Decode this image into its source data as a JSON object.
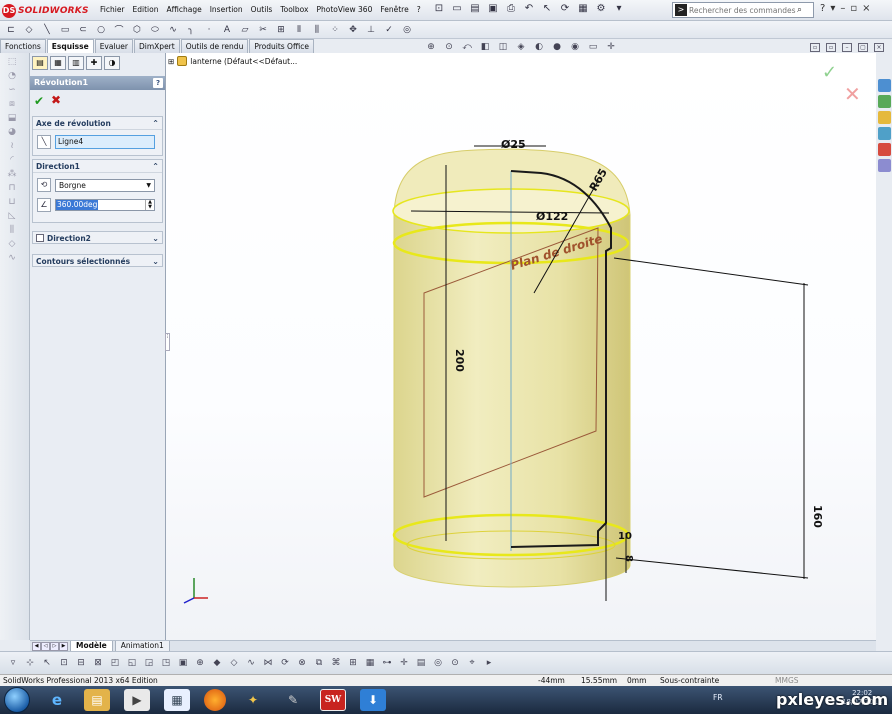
{
  "app": {
    "logo_text": "SOLIDWORKS",
    "logo_mark": "DS",
    "menus": [
      "Fichier",
      "Edition",
      "Affichage",
      "Insertion",
      "Outils",
      "Toolbox",
      "PhotoView 360",
      "Fenêtre",
      "?"
    ],
    "search": {
      "placeholder": "Rechercher des commandes",
      "prompt_glyph": ">"
    }
  },
  "tabs": [
    {
      "label": "Fonctions",
      "active": false
    },
    {
      "label": "Esquisse",
      "active": true
    },
    {
      "label": "Evaluer",
      "active": false
    },
    {
      "label": "DimXpert",
      "active": false
    },
    {
      "label": "Outils de rendu",
      "active": false
    },
    {
      "label": "Produits Office",
      "active": false
    }
  ],
  "feature_tree": {
    "root_label": "lanterne  (Défaut<<Défaut..."
  },
  "property_manager": {
    "title": "Révolution1",
    "help": "?",
    "axis_group": {
      "title": "Axe de révolution",
      "axis_value": "Ligne4"
    },
    "direction1": {
      "title": "Direction1",
      "type_value": "Borgne",
      "angle_value": "360.00deg"
    },
    "direction2": {
      "title": "Direction2"
    },
    "contours": {
      "title": "Contours sélectionnés"
    }
  },
  "dimensions": {
    "d_top": "Ø25",
    "d_body": "Ø122",
    "radius": "R65",
    "height_left": "200",
    "height_right": "160",
    "small_bottom": "10",
    "small_side": "8",
    "plane_label": "Plan de droite"
  },
  "bottom_tabs": [
    {
      "label": "Modèle",
      "active": true
    },
    {
      "label": "Animation1",
      "active": false
    }
  ],
  "status": {
    "product": "SolidWorks Professional 2013 x64 Edition",
    "x": "-44mm",
    "y": "15.55mm",
    "z": "0mm",
    "state": "Sous-contrainte",
    "units": "MMGS"
  },
  "taskbar": {
    "sw_label": "SW",
    "lang": "FR",
    "time": "22:02",
    "date": "18/07/2013"
  },
  "watermark": "pxleyes.com",
  "colors": {
    "body_fill": "#ece7a8",
    "body_edge": "#e6e61e",
    "sketch_line": "#1a1a1a",
    "plane_border": "#9b5a3a",
    "plane_label": "#a0522d",
    "accent_red": "#d71920",
    "pm_title_bg": "#8ea3bd"
  }
}
